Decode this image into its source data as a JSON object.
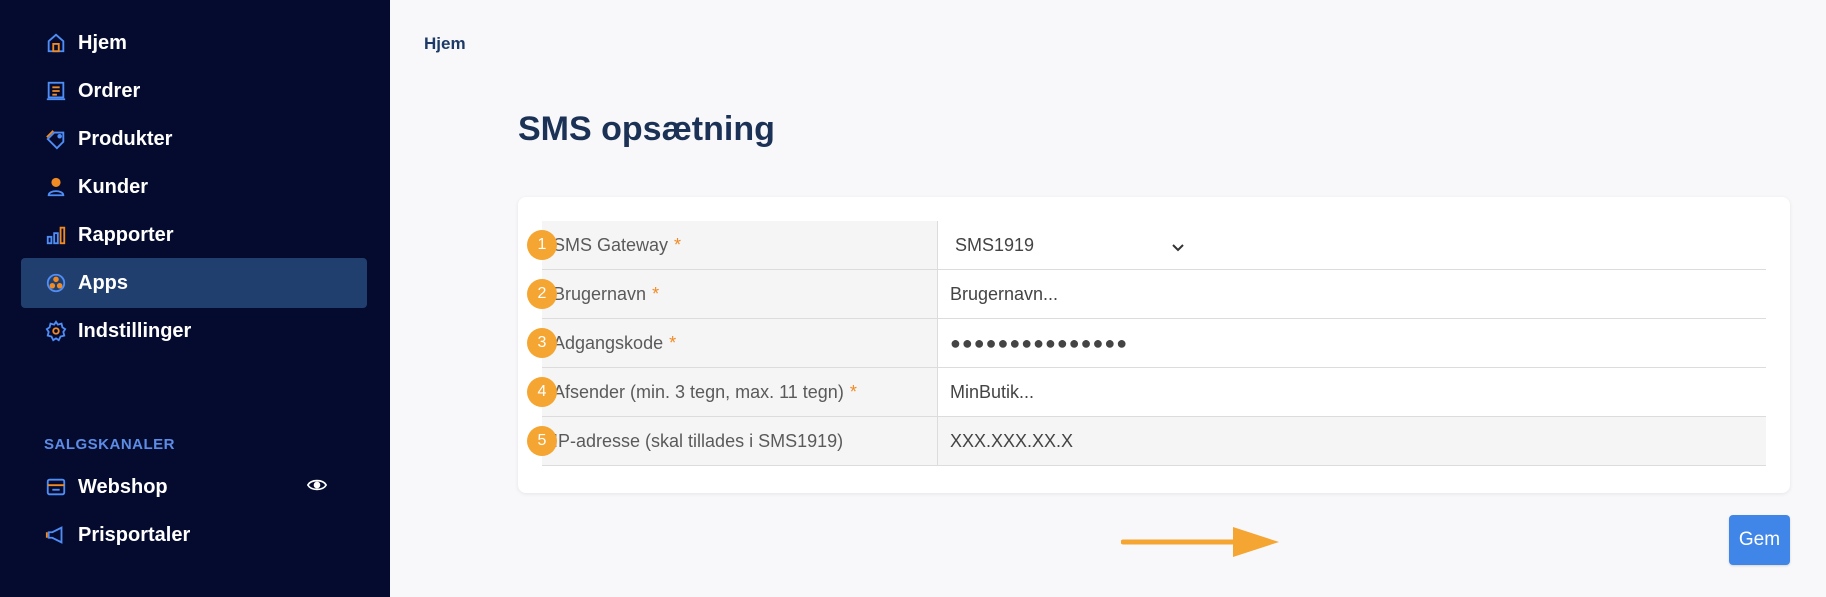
{
  "sidebar": {
    "items": [
      {
        "label": "Hjem",
        "icon": "home-icon"
      },
      {
        "label": "Ordrer",
        "icon": "orders-icon"
      },
      {
        "label": "Produkter",
        "icon": "tag-icon"
      },
      {
        "label": "Kunder",
        "icon": "user-icon"
      },
      {
        "label": "Rapporter",
        "icon": "bar-chart-icon"
      },
      {
        "label": "Apps",
        "icon": "apps-icon",
        "active": true
      },
      {
        "label": "Indstillinger",
        "icon": "gear-icon"
      }
    ],
    "section_label": "SALGSKANALER",
    "channels": [
      {
        "label": "Webshop",
        "icon": "store-icon"
      },
      {
        "label": "Prisportaler",
        "icon": "megaphone-icon"
      }
    ]
  },
  "breadcrumb": "Hjem",
  "page_title": "SMS opsætning",
  "form": {
    "rows": [
      {
        "num": "1",
        "label": "SMS Gateway",
        "required": "*",
        "value": "SMS1919"
      },
      {
        "num": "2",
        "label": "Brugernavn",
        "required": "*",
        "value": "Brugernavn..."
      },
      {
        "num": "3",
        "label": "Adgangskode",
        "required": "*",
        "value": "●●●●●●●●●●●●●●●"
      },
      {
        "num": "4",
        "label": "Afsender (min. 3 tegn, max. 11 tegn)",
        "required": "*",
        "value": "MinButik..."
      },
      {
        "num": "5",
        "label": "IP-adresse (skal tillades i SMS1919)",
        "required": "",
        "value": "XXX.XXX.XX.X"
      }
    ]
  },
  "save_label": "Gem",
  "colors": {
    "sidebar_bg": "#050b2e",
    "active_bg": "#213f6e",
    "accent_orange": "#f5a531",
    "primary_button": "#3f86e8"
  }
}
